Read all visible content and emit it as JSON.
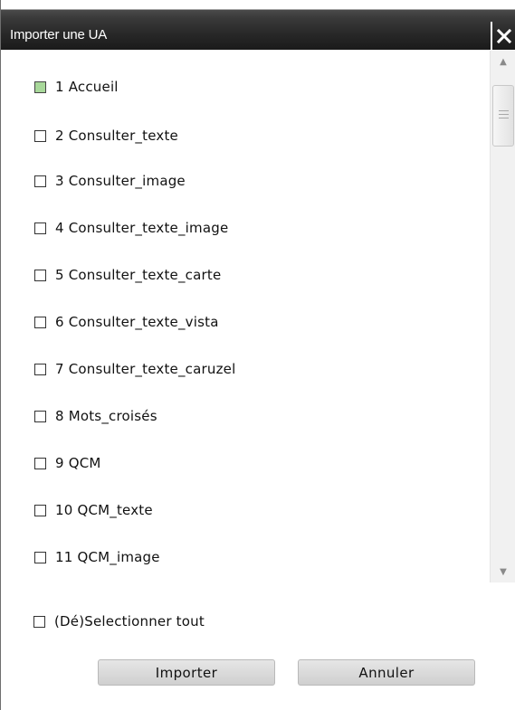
{
  "dialog": {
    "title": "Importer une UA",
    "close_label": "X"
  },
  "items": [
    {
      "label": "1 Accueil",
      "checked": true
    },
    {
      "label": "2 Consulter_texte",
      "checked": false
    },
    {
      "label": "3 Consulter_image",
      "checked": false
    },
    {
      "label": "4 Consulter_texte_image",
      "checked": false
    },
    {
      "label": "5 Consulter_texte_carte",
      "checked": false
    },
    {
      "label": "6 Consulter_texte_vista",
      "checked": false
    },
    {
      "label": "7 Consulter_texte_caruzel",
      "checked": false
    },
    {
      "label": "8 Mots_croisés",
      "checked": false
    },
    {
      "label": "9 QCM",
      "checked": false
    },
    {
      "label": "10 QCM_texte",
      "checked": false
    },
    {
      "label": "11 QCM_image",
      "checked": false
    }
  ],
  "select_all": {
    "label": "(Dé)Selectionner tout",
    "checked": false
  },
  "buttons": {
    "import_label": "Importer",
    "cancel_label": "Annuler"
  },
  "colors": {
    "checked_fill": "#a8d89a",
    "titlebar": "#262626"
  }
}
